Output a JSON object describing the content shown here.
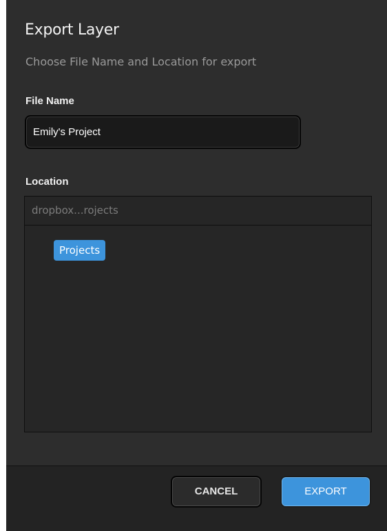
{
  "dialog": {
    "title": "Export Layer",
    "subtitle": "Choose File Name and Location for export"
  },
  "file_name": {
    "label": "File Name",
    "value": "Emily's Project"
  },
  "location": {
    "label": "Location",
    "path": "dropbox...rojects",
    "folders": [
      "Projects"
    ]
  },
  "buttons": {
    "cancel": "CANCEL",
    "export": "EXPORT"
  },
  "colors": {
    "accent": "#3d94dc",
    "background": "#2d2d2d",
    "footer": "#232323"
  }
}
